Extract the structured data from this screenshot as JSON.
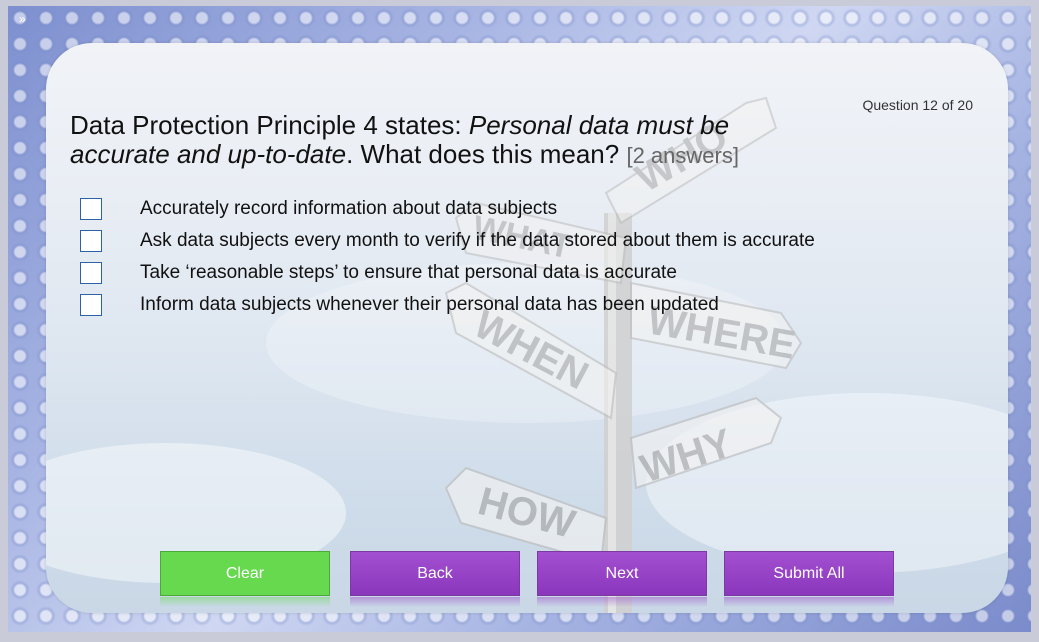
{
  "nav": {
    "collapse_glyph": "»"
  },
  "quiz": {
    "counter": "Question 12 of 20",
    "question_part1": "Data Protection Principle 4 states: ",
    "question_italic": "Personal data must be accurate and up-to-date",
    "question_part2": ". What does this mean? ",
    "question_hint": "[2 answers]",
    "options": [
      "Accurately record information about data subjects",
      "Ask data subjects every month to verify if the data stored about them is accurate",
      "Take ‘reasonable steps’ to ensure that personal data is accurate",
      "Inform data subjects whenever their personal data has been updated"
    ]
  },
  "signpost": {
    "labels": [
      "WHO",
      "WHAT",
      "WHERE",
      "WHEN",
      "WHY",
      "HOW"
    ]
  },
  "buttons": {
    "clear": "Clear",
    "back": "Back",
    "next": "Next",
    "submit": "Submit All"
  },
  "colors": {
    "clear_button": "#66d94e",
    "nav_button": "#9645c8",
    "checkbox_border": "#2c63a8"
  }
}
